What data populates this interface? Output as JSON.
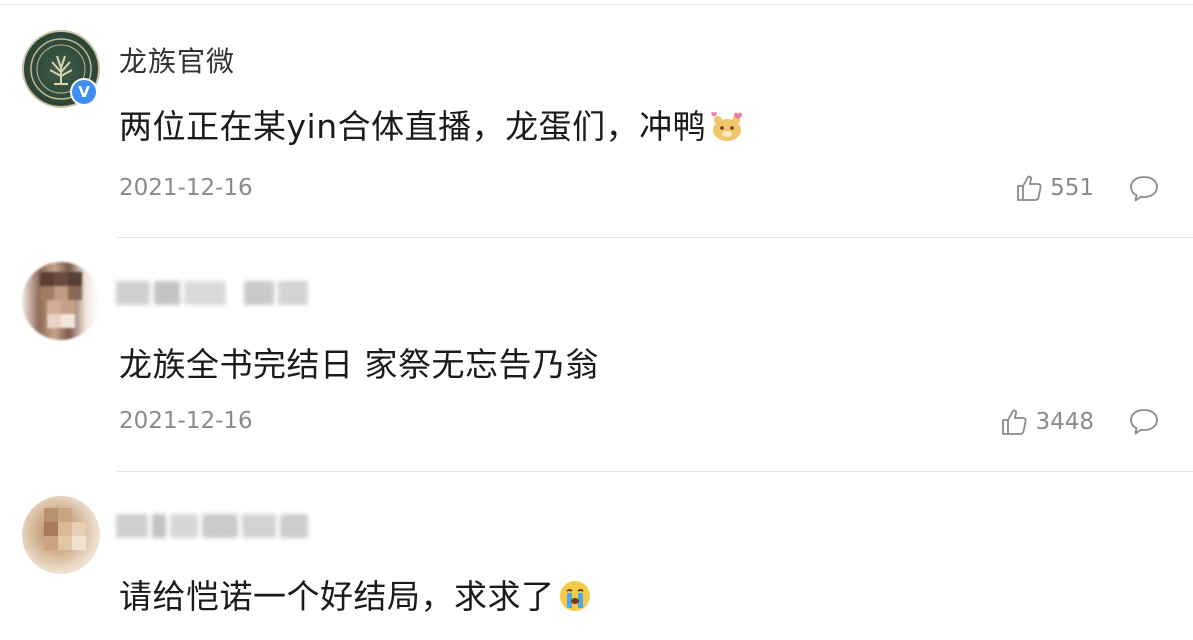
{
  "comments": [
    {
      "username": "龙族官微",
      "verified_mark": "V",
      "text": "两位正在某yin合体直播，龙蛋们，冲鸭",
      "emoji": "hamster-heart-emoji",
      "date": "2021-12-16",
      "likes": "551"
    },
    {
      "username_blurred": true,
      "text": "龙族全书完结日 家祭无忘告乃翁",
      "date": "2021-12-16",
      "likes": "3448"
    },
    {
      "username_blurred": true,
      "text": "请给恺诺一个好结局，求求了",
      "emoji": "crying-face-emoji"
    }
  ],
  "colors": {
    "verified_badge": "#3d8ef0",
    "meta_text": "#8a8a8a",
    "divider": "#e6e6e6"
  },
  "icons": {
    "like": "thumbs-up-icon",
    "reply": "speech-bubble-icon"
  }
}
